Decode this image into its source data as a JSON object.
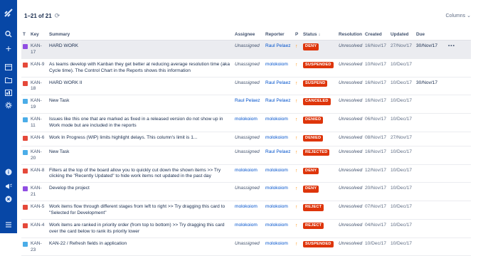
{
  "header": {
    "count": "1–21 of 21",
    "columns_label": "Columns"
  },
  "table": {
    "headers": [
      "T",
      "Key",
      "Summary",
      "Assignee",
      "Reporter",
      "P",
      "Status",
      "Resolution",
      "Created",
      "Updated",
      "Due"
    ],
    "status_sort_indicator": "↓",
    "rows": [
      {
        "type": "epic",
        "key": "KAN-17",
        "summary": "HARD WORK",
        "assignee": "Unassigned",
        "assignee_link": false,
        "reporter": "Raul Pelaez",
        "status": "DENY",
        "resolution": "Unresolved",
        "created": "16/Nov/17",
        "updated": "27/Nov/17",
        "due": "30/Nov/17",
        "selected": true
      },
      {
        "type": "bug",
        "key": "KAN-9",
        "summary": "As teams develop with Kanban they get better at reducing average resolution time (aka Cycle time). The Control Chart in the Reports shows this information",
        "assignee": "Unassigned",
        "assignee_link": false,
        "reporter": "molokoiom",
        "status": "SUSPENDED",
        "resolution": "Unresolved",
        "created": "10/Nov/17",
        "updated": "10/Dec/17",
        "due": ""
      },
      {
        "type": "bug",
        "key": "KAN-18",
        "summary": "HARD WORK II",
        "assignee": "Unassigned",
        "assignee_link": false,
        "reporter": "Raul Pelaez",
        "status": "SUSPEND",
        "resolution": "Unresolved",
        "created": "16/Nov/17",
        "updated": "10/Dec/17",
        "due": "30/Nov/17"
      },
      {
        "type": "task",
        "key": "KAN-19",
        "summary": "New Task",
        "assignee": "Raul Pelaez",
        "assignee_link": true,
        "reporter": "Raul Pelaez",
        "status": "CANCELED",
        "resolution": "Unresolved",
        "created": "16/Nov/17",
        "updated": "10/Dec/17",
        "due": ""
      },
      {
        "type": "task",
        "key": "KAN-11",
        "summary": "Issues like this one that are marked as fixed in a released version do not show up in Work mode but are included in the reports",
        "assignee": "molokoiom",
        "assignee_link": true,
        "reporter": "molokoiom",
        "status": "DENIED",
        "resolution": "Unresolved",
        "created": "06/Nov/17",
        "updated": "10/Dec/17",
        "due": ""
      },
      {
        "type": "bug",
        "key": "KAN-6",
        "summary": "Work In Progress (WIP) limits highlight delays. This column's limit is 1...",
        "assignee": "Unassigned",
        "assignee_link": false,
        "reporter": "molokoiom",
        "status": "DENIED",
        "resolution": "Unresolved",
        "created": "08/Nov/17",
        "updated": "27/Nov/17",
        "due": ""
      },
      {
        "type": "task",
        "key": "KAN-20",
        "summary": "New Task",
        "assignee": "Unassigned",
        "assignee_link": false,
        "reporter": "Raul Pelaez",
        "status": "REJECTED",
        "resolution": "Unresolved",
        "created": "16/Nov/17",
        "updated": "10/Dec/17",
        "due": ""
      },
      {
        "type": "bug",
        "key": "KAN-8",
        "summary": "Filters at the top of the board allow you to quickly cut down the shown items >> Try clicking the \"Recently Updated\" to hide work items not updated in the past day",
        "assignee": "molokoiom",
        "assignee_link": true,
        "reporter": "molokoiom",
        "status": "DENY",
        "resolution": "Unresolved",
        "created": "12/Nov/17",
        "updated": "10/Dec/17",
        "due": ""
      },
      {
        "type": "epic",
        "key": "KAN-21",
        "summary": "Develop the project",
        "assignee": "Unassigned",
        "assignee_link": false,
        "reporter": "molokoiom",
        "status": "DENY",
        "resolution": "Unresolved",
        "created": "20/Nov/17",
        "updated": "10/Dec/17",
        "due": ""
      },
      {
        "type": "bug",
        "key": "KAN-5",
        "summary": "Work items flow through different stages from left to right >> Try dragging this card to \"Selected for Development\"",
        "assignee": "molokoiom",
        "assignee_link": true,
        "reporter": "molokoiom",
        "status": "REJECT",
        "resolution": "Unresolved",
        "created": "07/Nov/17",
        "updated": "10/Dec/17",
        "due": ""
      },
      {
        "type": "bug",
        "key": "KAN-4",
        "summary": "Work items are ranked in priority order (from top to bottom) >> Try dragging this card over the card below to rank its priority lower",
        "assignee": "molokoiom",
        "assignee_link": true,
        "reporter": "molokoiom",
        "status": "REJECT",
        "resolution": "Unresolved",
        "created": "04/Nov/17",
        "updated": "10/Dec/17",
        "due": ""
      },
      {
        "type": "sub",
        "key": "KAN-23",
        "summary": "KAN-22 / Refresh fields in application",
        "assignee": "Unassigned",
        "assignee_link": false,
        "reporter": "molokoiom",
        "status": "SUSPENDED",
        "resolution": "Unresolved",
        "created": "10/Dec/17",
        "updated": "10/Dec/17",
        "due": ""
      }
    ]
  },
  "colors": {
    "sidebar": "#0747a6",
    "status_red": "#de350b",
    "link": "#0052cc",
    "priority": "#ff8b00"
  }
}
